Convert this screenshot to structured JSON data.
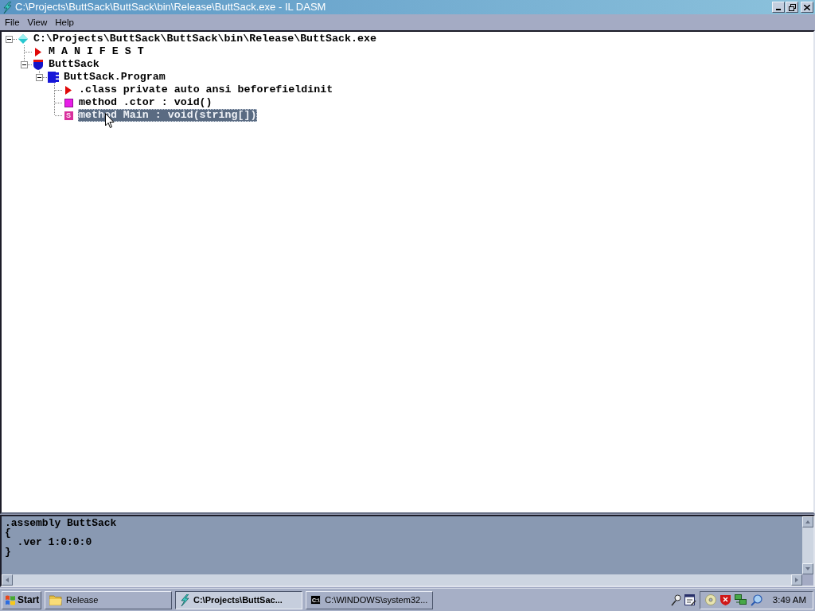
{
  "window": {
    "title": "C:\\Projects\\ButtSack\\ButtSack\\bin\\Release\\ButtSack.exe - IL DASM"
  },
  "menu": [
    {
      "label": "File"
    },
    {
      "label": "View"
    },
    {
      "label": "Help"
    }
  ],
  "tree": [
    {
      "kind": "assembly",
      "label": "C:\\Projects\\ButtSack\\ButtSack\\bin\\Release\\ButtSack.exe",
      "expanded": true,
      "selected": false,
      "children": [
        {
          "kind": "manifest",
          "label": "M A N I F E S T",
          "selected": false
        },
        {
          "kind": "namespace",
          "label": "ButtSack",
          "expanded": true,
          "selected": false,
          "children": [
            {
              "kind": "class",
              "label": "ButtSack.Program",
              "expanded": true,
              "selected": false,
              "children": [
                {
                  "kind": "info",
                  "label": ".class private auto ansi beforefieldinit",
                  "selected": false
                },
                {
                  "kind": "method",
                  "label": "method .ctor : void()",
                  "selected": false
                },
                {
                  "kind": "static_method",
                  "label": "method Main : void(string[])",
                  "icon_letter": "S",
                  "selected": true
                }
              ]
            }
          ]
        }
      ]
    }
  ],
  "info_pane": {
    "lines": [
      ".assembly ButtSack",
      "{",
      "  .ver 1:0:0:0",
      "}"
    ]
  },
  "taskbar": {
    "start": "Start",
    "tasks": [
      {
        "kind": "folder",
        "label": "Release",
        "selected": false
      },
      {
        "kind": "ildasm",
        "label": "C:\\Projects\\ButtSac...",
        "selected": true
      },
      {
        "kind": "console",
        "label": "C:\\WINDOWS\\system32...",
        "icon_text": "C:\\",
        "selected": false
      }
    ],
    "clock": "3:49 AM"
  }
}
